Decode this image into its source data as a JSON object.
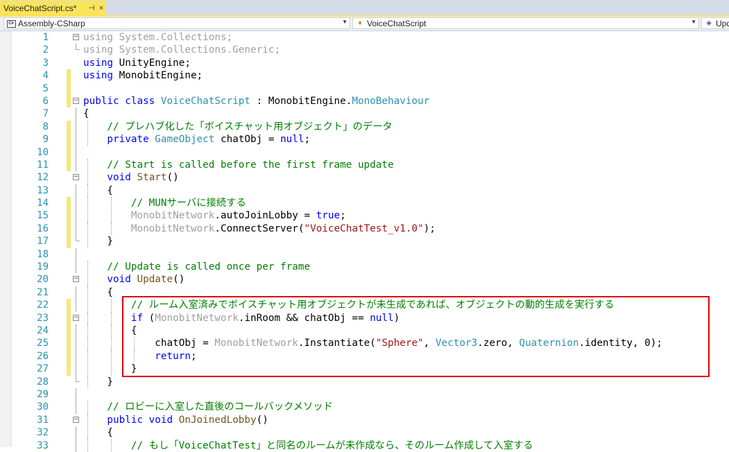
{
  "tab": {
    "title": "VoiceChatScript.cs*",
    "pin_glyph": "⊣",
    "close_glyph": "×"
  },
  "nav": {
    "project": "Assembly-CSharp",
    "class": "VoiceChatScript",
    "member": "Upd"
  },
  "icons": {
    "tab_pin": "pin-icon",
    "tab_close": "close-icon",
    "dropdown_arrow": "chevron-down-icon"
  },
  "colors": {
    "keyword": "#0000ff",
    "type": "#2b91af",
    "comment": "#008000",
    "string": "#a31515",
    "highlight_box": "#e00000",
    "tab_active": "#fbe45a"
  },
  "lines": [
    {
      "n": "1",
      "t": [
        [
          "gr",
          "using System.Collections;"
        ]
      ]
    },
    {
      "n": "2",
      "t": [
        [
          "gr",
          "using System.Collections.Generic;"
        ]
      ]
    },
    {
      "n": "3",
      "t": [
        [
          "kw",
          "using"
        ],
        [
          "",
          "UnityEngine;"
        ]
      ]
    },
    {
      "n": "4",
      "t": [
        [
          "kw",
          "using"
        ],
        [
          "",
          "MonobitEngine;"
        ]
      ]
    },
    {
      "n": "5",
      "t": []
    },
    {
      "n": "6",
      "t": [
        [
          "kw",
          "public class"
        ],
        [
          "ty",
          "VoiceChatScript"
        ],
        [
          "",
          " : MonobitEngine."
        ],
        [
          "ty",
          "MonoBehaviour"
        ]
      ]
    },
    {
      "n": "7",
      "t": [
        [
          "",
          "{"
        ]
      ]
    },
    {
      "n": "8",
      "t": [
        [
          "cm",
          "    // プレハブ化した「ボイスチャット用オブジェクト」のデータ"
        ]
      ]
    },
    {
      "n": "9",
      "t": [
        [
          "kw",
          "    private"
        ],
        [
          "ty",
          "GameObject"
        ],
        [
          "",
          " chatObj = "
        ],
        [
          "kw",
          "null"
        ],
        [
          "",
          ";"
        ]
      ]
    },
    {
      "n": "10",
      "t": []
    },
    {
      "n": "11",
      "t": [
        [
          "cm",
          "    // Start is called before the first frame update"
        ]
      ]
    },
    {
      "n": "12",
      "t": [
        [
          "kw",
          "    void"
        ],
        [
          "fn",
          "Start"
        ],
        [
          "",
          "()"
        ]
      ]
    },
    {
      "n": "13",
      "t": [
        [
          "",
          "    {"
        ]
      ]
    },
    {
      "n": "14",
      "t": [
        [
          "cm",
          "        // MUNサーバに接続する"
        ]
      ]
    },
    {
      "n": "15",
      "t": [
        [
          "gr",
          "        MonobitNetwork"
        ],
        [
          "",
          ".autoJoinLobby = "
        ],
        [
          "kw",
          "true"
        ],
        [
          "",
          ";"
        ]
      ]
    },
    {
      "n": "16",
      "t": [
        [
          "gr",
          "        MonobitNetwork"
        ],
        [
          "",
          ".ConnectServer("
        ],
        [
          "st",
          "\"VoiceChatTest_v1.0\""
        ],
        [
          "",
          ");"
        ]
      ]
    },
    {
      "n": "17",
      "t": [
        [
          "",
          "    }"
        ]
      ]
    },
    {
      "n": "18",
      "t": []
    },
    {
      "n": "19",
      "t": [
        [
          "cm",
          "    // Update is called once per frame"
        ]
      ]
    },
    {
      "n": "20",
      "t": [
        [
          "kw",
          "    void"
        ],
        [
          "fn",
          "Update"
        ],
        [
          "",
          "()"
        ]
      ]
    },
    {
      "n": "21",
      "t": [
        [
          "",
          "    {"
        ]
      ]
    },
    {
      "n": "22",
      "t": [
        [
          "cm",
          "        // ルーム入室済みでボイスチャット用オブジェクトが未生成であれば、オブジェクトの動的生成を実行する"
        ]
      ]
    },
    {
      "n": "23",
      "t": [
        [
          "kw",
          "        if"
        ],
        [
          "",
          " ("
        ],
        [
          "gr",
          "MonobitNetwork"
        ],
        [
          "",
          ".inRoom && chatObj == "
        ],
        [
          "kw",
          "null"
        ],
        [
          "",
          ")"
        ]
      ]
    },
    {
      "n": "24",
      "t": [
        [
          "",
          "        {"
        ]
      ]
    },
    {
      "n": "25",
      "t": [
        [
          "",
          "            chatObj = "
        ],
        [
          "gr",
          "MonobitNetwork"
        ],
        [
          "",
          ".Instantiate("
        ],
        [
          "st",
          "\"Sphere\""
        ],
        [
          "",
          ", "
        ],
        [
          "ty",
          "Vector3"
        ],
        [
          "",
          ".zero, "
        ],
        [
          "ty",
          "Quaternion"
        ],
        [
          "",
          ".identity, 0);"
        ]
      ]
    },
    {
      "n": "26",
      "t": [
        [
          "kw",
          "            return"
        ],
        [
          "",
          ";"
        ]
      ]
    },
    {
      "n": "27",
      "t": [
        [
          "",
          "        }"
        ]
      ]
    },
    {
      "n": "28",
      "t": [
        [
          "",
          "    }"
        ]
      ]
    },
    {
      "n": "29",
      "t": []
    },
    {
      "n": "30",
      "t": [
        [
          "cm",
          "    // ロビーに入室した直後のコールバックメソッド"
        ]
      ]
    },
    {
      "n": "31",
      "t": [
        [
          "kw",
          "    public void"
        ],
        [
          "fn",
          "OnJoinedLobby"
        ],
        [
          "",
          "()"
        ]
      ]
    },
    {
      "n": "32",
      "t": [
        [
          "",
          "    {"
        ]
      ]
    },
    {
      "n": "33",
      "t": [
        [
          "cm",
          "        // もし「VoiceChatTest」と同名のルームが未作成なら、そのルーム作成して入室する"
        ]
      ]
    }
  ]
}
